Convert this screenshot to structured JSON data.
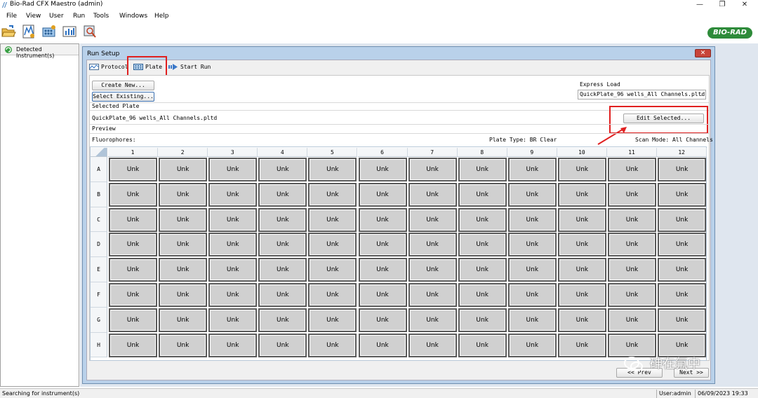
{
  "window": {
    "title": "Bio-Rad CFX Maestro (admin)",
    "minimize": "—",
    "restore": "❐",
    "close": "✕"
  },
  "menu": [
    "File",
    "View",
    "User",
    "Run",
    "Tools",
    "Windows",
    "Help"
  ],
  "toolbar": {
    "icons": [
      "open-folder-icon",
      "new-protocol-icon",
      "new-plate-icon",
      "data-analysis-icon",
      "search-report-icon"
    ]
  },
  "brand": {
    "logo_text": "BIO-RAD",
    "color": "#2e8b3a"
  },
  "left_panel": {
    "title": "Detected Instrument(s)"
  },
  "run_setup": {
    "title": "Run Setup",
    "tabs": [
      {
        "label": "Protocol",
        "icon": "protocol-icon"
      },
      {
        "label": "Plate",
        "icon": "plate-icon"
      },
      {
        "label": "Start Run",
        "icon": "start-run-icon"
      }
    ],
    "create_new": "Create New...",
    "select_existing": "Select Existing...",
    "express_load_label": "Express Load",
    "express_load_value": "QuickPlate_96 wells_All Channels.pltd",
    "selected_plate_label": "Selected Plate",
    "selected_plate_value": "QuickPlate_96 wells_All Channels.pltd",
    "edit_selected": "Edit Selected...",
    "preview_label": "Preview",
    "fluorophores_label": "Fluorophores:",
    "plate_type": "Plate Type: BR Clear",
    "scan_mode": "Scan Mode: All Channels",
    "prev_button": "<< Prev",
    "next_button": "Next >>"
  },
  "plate": {
    "columns": [
      "1",
      "2",
      "3",
      "4",
      "5",
      "6",
      "7",
      "8",
      "9",
      "10",
      "11",
      "12"
    ],
    "rows": [
      "A",
      "B",
      "C",
      "D",
      "E",
      "F",
      "G",
      "H"
    ],
    "well_label": "Unk"
  },
  "watermark": "砷在氟中",
  "status": {
    "message": "Searching for instrument(s)",
    "user": "User:admin",
    "datetime": "06/09/2023 19:33"
  }
}
